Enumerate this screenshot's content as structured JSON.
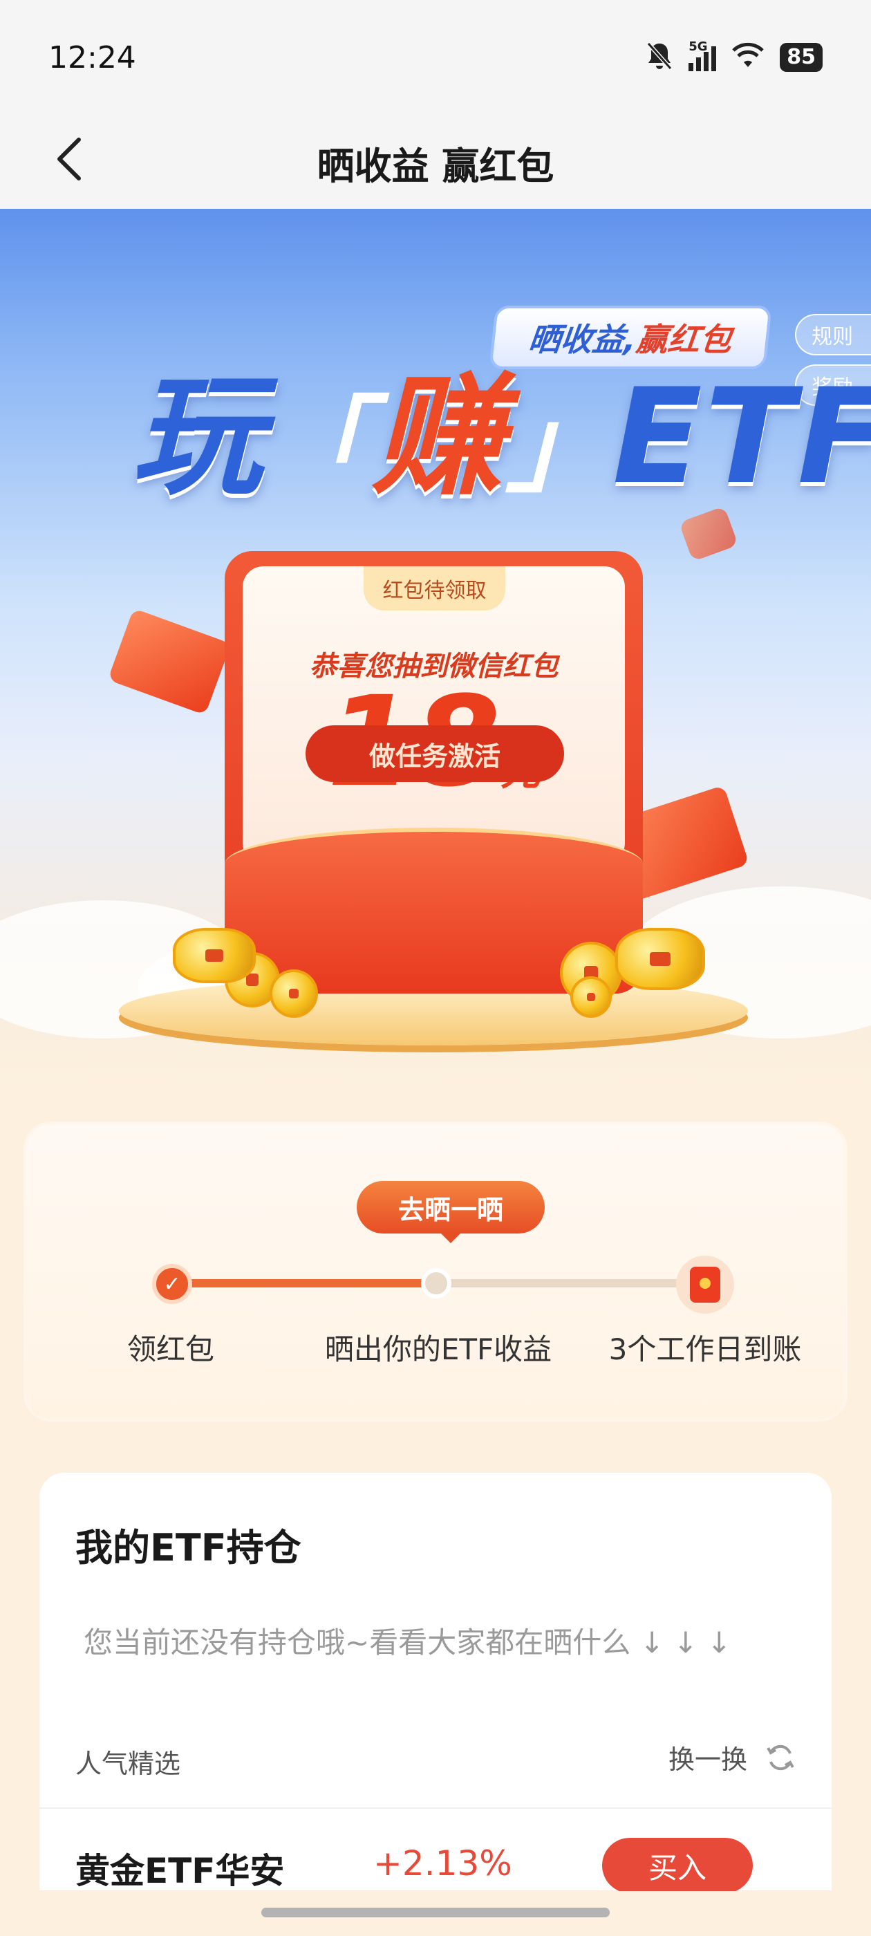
{
  "status_bar": {
    "time": "12:24",
    "battery": "85",
    "network": "5G",
    "icons": [
      "bell-muted-icon",
      "signal-5g-icon",
      "wifi-icon",
      "battery-icon"
    ]
  },
  "nav": {
    "title": "晒收益 赢红包",
    "back_icon": "chevron-left-icon"
  },
  "hero": {
    "tag_part1": "晒收益,",
    "tag_part2": "赢红包",
    "rules_label": "规则",
    "rewards_label": "奖励",
    "title_part1": "玩",
    "title_part2": "赚",
    "title_part3": "ETF",
    "envelope": {
      "status_pill": "红包待领取",
      "message": "恭喜您抽到微信红包",
      "amount": "18",
      "unit": "元",
      "action_label": "做任务激活"
    }
  },
  "steps": {
    "bubble": "去晒一晒",
    "items": [
      {
        "label": "领红包",
        "state": "done"
      },
      {
        "label": "晒出你的ETF收益",
        "state": "current"
      },
      {
        "label": "3个工作日到账",
        "state": "pending"
      }
    ]
  },
  "holdings": {
    "title": "我的ETF持仓",
    "empty_text": "您当前还没有持仓哦~看看大家都在晒什么 ↓ ↓ ↓"
  },
  "picks": {
    "label": "人气精选",
    "refresh_label": "换一换",
    "refresh_icon": "refresh-icon",
    "funds": [
      {
        "name": "黄金ETF华安",
        "change": "+2.13%",
        "buy_label": "买入"
      }
    ]
  },
  "colors": {
    "accent": "#e84a3a",
    "brand_blue": "#2e62d8",
    "orange": "#ec5a2a"
  }
}
